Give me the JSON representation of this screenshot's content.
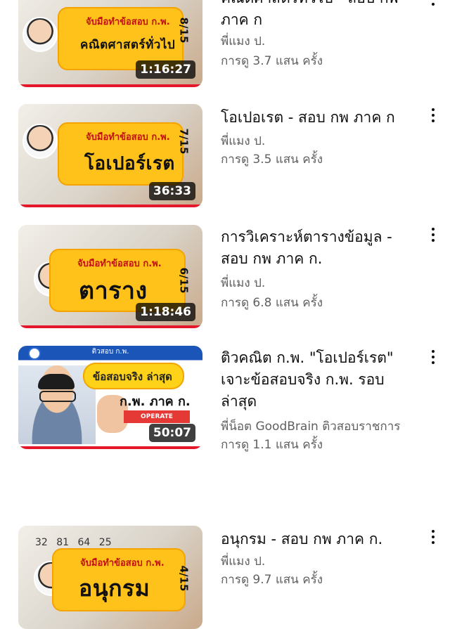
{
  "videos": [
    {
      "title": "คณิตศาสตร์ทั่วไป - สอบ กพ ภาค ก",
      "channel": "พี่แมง ป.",
      "views": "การดู 3.7 แสน ครั้ง",
      "duration": "1:16:27",
      "thumb_sub": "จับมือทำข้อสอบ ก.พ.",
      "thumb_main": "คณิตศาสตร์ทั่วไป",
      "thumb_ep": "8/15"
    },
    {
      "title": "โอเปอเรต - สอบ กพ ภาค ก",
      "channel": "พี่แมง ป.",
      "views": "การดู 3.5 แสน ครั้ง",
      "duration": "36:33",
      "thumb_sub": "จับมือทำข้อสอบ ก.พ.",
      "thumb_main": "โอเปอร์เรต",
      "thumb_ep": "7/15"
    },
    {
      "title": "การวิเคราะห์ตารางข้อมูล - สอบ กพ ภาค ก.",
      "channel": "พี่แมง ป.",
      "views": "การดู 6.8 แสน ครั้ง",
      "duration": "1:18:46",
      "thumb_sub": "จับมือทำข้อสอบ ก.พ.",
      "thumb_main": "ตาราง",
      "thumb_ep": "6/15"
    },
    {
      "title": "ติวคณิต ก.พ. \"โอเปอร์เรต\" เจาะข้อสอบจริง ก.พ. รอบล่าสุด",
      "channel": "พี่น็อต GoodBrain ติวสอบราชการ",
      "views": "การดู 1.1 แสน ครั้ง",
      "duration": "50:07",
      "thumb_top": "ติวสอบ ก.พ.",
      "thumb_pill": "ข้อสอบจริง ล่าสุด",
      "thumb_kp": "ก.พ. ภาค ก.",
      "thumb_red": "OPERATE"
    },
    {
      "title": "อนุกรม - สอบ กพ ภาค ก.",
      "channel": "พี่แมง ป.",
      "views": "การดู 9.7 แสน ครั้ง",
      "thumb_sub": "จับมือทำข้อสอบ ก.พ.",
      "thumb_main": "อนุกรม",
      "thumb_ep": "4/15",
      "thumb_numbers": "32 81 64 25"
    }
  ],
  "colors": {
    "progress": "#e4182a",
    "banner": "#ffc21a",
    "meta_text": "#606060"
  },
  "icons": {
    "more": "more-vert-icon"
  }
}
